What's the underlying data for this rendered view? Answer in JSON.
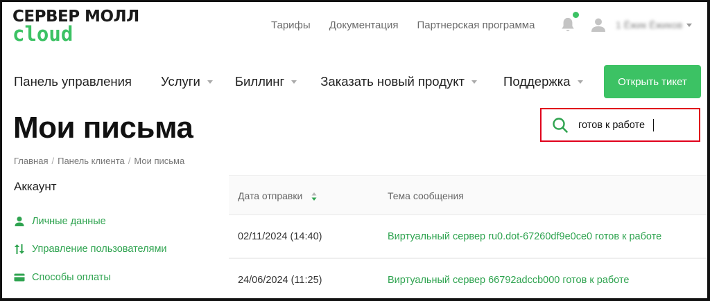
{
  "logo": {
    "line1": "СЕРВЕР МОЛЛ",
    "line2": "cloud"
  },
  "toplinks": [
    "Тарифы",
    "Документация",
    "Партнерская программа"
  ],
  "user": {
    "name": "1 Ёжик Ёжиков"
  },
  "nav": {
    "items": [
      {
        "label": "Панель управления",
        "dropdown": false
      },
      {
        "label": "Услуги",
        "dropdown": true
      },
      {
        "label": "Биллинг",
        "dropdown": true
      },
      {
        "label": "Заказать новый продукт",
        "dropdown": true
      },
      {
        "label": "Поддержка",
        "dropdown": true
      }
    ],
    "ticket_button": "Открыть тикет"
  },
  "page": {
    "title": "Мои письма"
  },
  "search": {
    "value": "готов к работе",
    "icon": "search-icon"
  },
  "breadcrumb": [
    "Главная",
    "Панель клиента",
    "Мои письма"
  ],
  "sidebar": {
    "title": "Аккаунт",
    "items": [
      {
        "label": "Личные данные",
        "icon": "user-icon"
      },
      {
        "label": "Управление пользователями",
        "icon": "sort-arrows-icon"
      },
      {
        "label": "Способы оплаты",
        "icon": "credit-card-icon"
      }
    ]
  },
  "table": {
    "headers": {
      "date": "Дата отправки",
      "subject": "Тема сообщения"
    },
    "rows": [
      {
        "date": "02/11/2024 (14:40)",
        "subject": "Виртуальный сервер ru0.dot-67260df9e0ce0 готов к работе"
      },
      {
        "date": "24/06/2024 (11:25)",
        "subject": "Виртуальный сервер 66792adccb000 готов к работе"
      }
    ]
  },
  "colors": {
    "brand_green": "#3cc264",
    "link_green": "#2ea34f",
    "highlight_red": "#e0001b"
  }
}
